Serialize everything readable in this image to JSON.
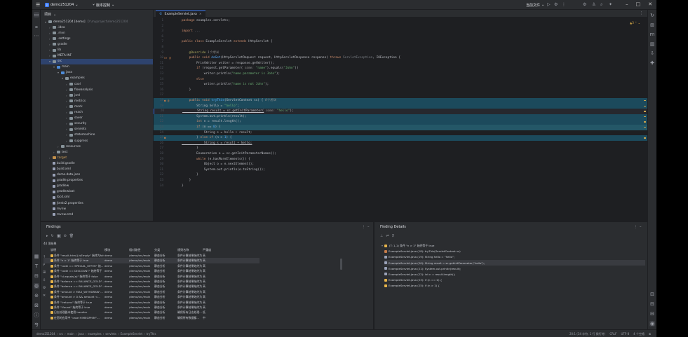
{
  "titlebar": {
    "project_badge": "D",
    "project_name": "demo251204",
    "vcs_branch": "版本控制",
    "run_config": "当前文件",
    "menu_icon": "hamburger-menu-icon"
  },
  "left_strip": [
    "folder-icon",
    "structure-icon",
    "more-icon"
  ],
  "left_strip_bottom": [
    "plugins-icon",
    "terminal-icon",
    "services-icon",
    "problems-icon",
    "debug-icon",
    "git-icon",
    "run-icon",
    "todo-icon"
  ],
  "right_strip": [
    "notifications-icon",
    "database-icon",
    "ai-icon",
    "gradle-icon",
    "chart-icon",
    "copilot-icon"
  ],
  "right_strip_bottom": [
    "bookmarks-icon",
    "structure-icon",
    "outline-icon"
  ],
  "project": {
    "title": "项目",
    "tree": [
      {
        "indent": 1,
        "arrow": "▾",
        "type": "folder",
        "label": "demo251204 [demo]",
        "hint": "D:\\myproject\\demo251204"
      },
      {
        "indent": 2,
        "arrow": "›",
        "type": "folder",
        "label": ".idea"
      },
      {
        "indent": 2,
        "arrow": "›",
        "type": "folder",
        "label": ".mvn"
      },
      {
        "indent": 2,
        "arrow": "›",
        "type": "folder",
        "label": ".settings"
      },
      {
        "indent": 2,
        "arrow": "›",
        "type": "folder",
        "label": "gradle"
      },
      {
        "indent": 2,
        "arrow": "›",
        "type": "folder",
        "label": "lib"
      },
      {
        "indent": 2,
        "arrow": "›",
        "type": "folder",
        "label": "META-INF"
      },
      {
        "indent": 2,
        "arrow": "▾",
        "type": "folder",
        "label": "src",
        "selected": true
      },
      {
        "indent": 3,
        "arrow": "▾",
        "type": "src",
        "label": "main"
      },
      {
        "indent": 4,
        "arrow": "▾",
        "type": "src",
        "label": "java"
      },
      {
        "indent": 5,
        "arrow": "▾",
        "type": "folder",
        "label": "examples"
      },
      {
        "indent": 6,
        "arrow": "›",
        "type": "folder",
        "label": "cool"
      },
      {
        "indent": 6,
        "arrow": "›",
        "type": "folder",
        "label": "flowanalysis"
      },
      {
        "indent": 6,
        "arrow": "›",
        "type": "folder",
        "label": "jsrd"
      },
      {
        "indent": 6,
        "arrow": "›",
        "type": "folder",
        "label": "metrics"
      },
      {
        "indent": 6,
        "arrow": "›",
        "type": "folder",
        "label": "mock"
      },
      {
        "indent": 6,
        "arrow": "›",
        "type": "folder",
        "label": "reach"
      },
      {
        "indent": 6,
        "arrow": "›",
        "type": "folder",
        "label": "saver"
      },
      {
        "indent": 6,
        "arrow": "›",
        "type": "folder",
        "label": "security"
      },
      {
        "indent": 6,
        "arrow": "›",
        "type": "folder",
        "label": "servlets"
      },
      {
        "indent": 6,
        "arrow": "›",
        "type": "folder",
        "label": "statemachine"
      },
      {
        "indent": 6,
        "arrow": "›",
        "type": "folder",
        "label": "suppress"
      },
      {
        "indent": 4,
        "arrow": "›",
        "type": "folder",
        "label": "resources"
      },
      {
        "indent": 3,
        "arrow": "›",
        "type": "folder",
        "label": "test"
      },
      {
        "indent": 2,
        "arrow": "›",
        "type": "target",
        "label": "target",
        "target": true
      },
      {
        "indent": 2,
        "arrow": "",
        "type": "file",
        "label": "build.gradle"
      },
      {
        "indent": 2,
        "arrow": "",
        "type": "file",
        "label": "build.xml"
      },
      {
        "indent": 2,
        "arrow": "",
        "type": "file",
        "label": "demo.data.json"
      },
      {
        "indent": 2,
        "arrow": "",
        "type": "file",
        "label": "gradle.properties"
      },
      {
        "indent": 2,
        "arrow": "",
        "type": "file",
        "label": "gradlew"
      },
      {
        "indent": 2,
        "arrow": "",
        "type": "file",
        "label": "gradlew.bat"
      },
      {
        "indent": 2,
        "arrow": "",
        "type": "file",
        "label": "ibcd.xml"
      },
      {
        "indent": 2,
        "arrow": "",
        "type": "file",
        "label": "jtests2.properties"
      },
      {
        "indent": 2,
        "arrow": "",
        "type": "file",
        "label": "mvnw"
      },
      {
        "indent": 2,
        "arrow": "",
        "type": "file",
        "label": "mvnw.cmd"
      }
    ]
  },
  "editor": {
    "tab": "ExampleServlet.java",
    "inspection_badge": "▲3 ⌃ ⌄",
    "lines": [
      {
        "n": "1",
        "parts": [
          [
            "k",
            "package "
          ],
          [
            "",
            "examples.servlets;"
          ]
        ]
      },
      {
        "n": "2",
        "parts": []
      },
      {
        "n": "3",
        "parts": [
          [
            "k",
            "import "
          ],
          [
            "c",
            "..."
          ]
        ]
      },
      {
        "n": "6",
        "parts": []
      },
      {
        "n": "7",
        "parts": [
          [
            "k",
            "public class "
          ],
          [
            "",
            "ExampleServlet "
          ],
          [
            "k",
            "extends "
          ],
          [
            "",
            "HttpServlet {"
          ]
        ]
      },
      {
        "n": "8",
        "parts": []
      },
      {
        "n": "9",
        "parts": [
          [
            "a",
            "    @Override "
          ],
          [
            "h",
            "1个用法"
          ]
        ]
      },
      {
        "n": "10",
        "gut": "o↑ @",
        "parts": [
          [
            "k",
            "    public void "
          ],
          [
            "f",
            "doGet"
          ],
          [
            "",
            "(HttpServletRequest request, HttpServletResponse response) "
          ],
          [
            "k",
            "throws "
          ],
          [
            "c",
            "ServletException"
          ],
          [
            "",
            ", IOException {"
          ]
        ]
      },
      {
        "n": "11",
        "parts": [
          [
            "",
            "        PrintWriter writer = response.getWriter();"
          ]
        ]
      },
      {
        "n": "12",
        "parts": [
          [
            "k",
            "        if "
          ],
          [
            "",
            "(request.getParameter("
          ],
          [
            "h",
            " name: "
          ],
          [
            "s",
            "\"name\""
          ],
          [
            "",
            ").equals("
          ],
          [
            "s",
            "\"John\""
          ],
          [
            "",
            "))"
          ]
        ]
      },
      {
        "n": "13",
        "parts": [
          [
            "",
            "            writer.println("
          ],
          [
            "s",
            "\"name parameter is John\""
          ],
          [
            "",
            ");"
          ]
        ]
      },
      {
        "n": "14",
        "parts": [
          [
            "k",
            "        else"
          ]
        ]
      },
      {
        "n": "15",
        "parts": [
          [
            "",
            "            writer.println("
          ],
          [
            "s",
            "\"name is not John\""
          ],
          [
            "",
            ");"
          ]
        ]
      },
      {
        "n": "16",
        "parts": [
          [
            "",
            "    }"
          ]
        ]
      },
      {
        "n": "17",
        "parts": []
      },
      {
        "n": "18",
        "gut": "● @",
        "parts": [
          [
            "k",
            "    public void "
          ],
          [
            "f",
            "tryThis"
          ],
          [
            "",
            "(ServletContext sc) { "
          ],
          [
            "h",
            "0个用法"
          ]
        ],
        "hl": "hl"
      },
      {
        "n": "19",
        "parts": [
          [
            "",
            "        String hello = "
          ],
          [
            "s",
            "\"hello\""
          ],
          [
            "",
            ";"
          ]
        ],
        "hl": "hl"
      },
      {
        "n": "20",
        "parts": [
          [
            "u",
            "        String result = sc.getInitParameter("
          ],
          [
            "h",
            " name: "
          ],
          [
            "s",
            "\"hello\""
          ],
          [
            "",
            ");"
          ]
        ],
        "hl": "caret"
      },
      {
        "n": "21",
        "parts": [
          [
            "",
            "        System."
          ],
          [
            "",
            "out"
          ],
          [
            "",
            ".println(result);"
          ]
        ],
        "hl": "hl"
      },
      {
        "n": "22",
        "parts": [
          [
            "k",
            "        int "
          ],
          [
            "",
            "n = result.length();"
          ]
        ],
        "hl": "hl"
      },
      {
        "n": "23",
        "parts": [
          [
            "k",
            "        if "
          ],
          [
            "",
            "(n == "
          ],
          [
            "f",
            "0"
          ],
          [
            "",
            ") {"
          ]
        ],
        "hl": "hlc"
      },
      {
        "n": "24",
        "parts": [
          [
            "",
            "            String s = hello + result;"
          ]
        ]
      },
      {
        "n": "25",
        "gut": "●",
        "parts": [
          [
            "",
            "        } "
          ],
          [
            "k",
            "else if "
          ],
          [
            "",
            "(n > "
          ],
          [
            "f",
            "1"
          ],
          [
            "",
            ") {"
          ]
        ],
        "hl": "hl"
      },
      {
        "n": "26",
        "parts": [
          [
            "u",
            "            String s = result + hello;"
          ]
        ]
      },
      {
        "n": "27",
        "parts": [
          [
            "",
            "        }"
          ]
        ]
      },
      {
        "n": "28",
        "parts": [
          [
            "",
            "        Enumeration e = sc.getInitParameterNames();"
          ]
        ]
      },
      {
        "n": "29",
        "parts": [
          [
            "k",
            "        while "
          ],
          [
            "",
            "(e.hasMoreElements()) {"
          ]
        ]
      },
      {
        "n": "30",
        "parts": [
          [
            "",
            "            Object o = e.nextElement();"
          ]
        ]
      },
      {
        "n": "31",
        "parts": [
          [
            "",
            "            System."
          ],
          [
            "",
            "out"
          ],
          [
            "",
            ".println(o.toString());"
          ]
        ]
      },
      {
        "n": "32",
        "parts": [
          [
            "",
            "        }"
          ]
        ]
      },
      {
        "n": "33",
        "parts": [
          [
            "",
            "    }"
          ]
        ]
      },
      {
        "n": "34",
        "parts": [
          [
            "",
            "}"
          ]
        ]
      }
    ]
  },
  "findings": {
    "title": "Findings",
    "stat": "44 项结果",
    "columns": [
      "说明",
      "模块",
      "相对路径",
      "分类",
      "规则名称",
      "严重度"
    ],
    "rows": [
      [
        "条件 \"result.trim().isEmpty\" 始终为false",
        "demo",
        "/demo/src/main",
        "静态分析",
        "条件计算结果始终为...",
        "高"
      ],
      [
        "条件 \"n > 1\" 始终等于 true",
        "demo",
        "/demo/src/main",
        "静态分析",
        "条件计算结果始终为...",
        "高"
      ],
      [
        "条件 \"code == SPECIAL_OFFER\" 始...",
        "demo",
        "/demo/src/main",
        "静态分析",
        "条件计算结果始终为...",
        "高"
      ],
      [
        "条件 \"code == DISCOUNT\" 始终等于",
        "demo",
        "/demo/src/main",
        "静态分析",
        "条件计算结果始终为...",
        "高"
      ],
      [
        "条件 \"cl.equals(a)\" 始终等于 false",
        "demo",
        "/demo/src/main",
        "静态分析",
        "条件计算结果始终为...",
        "高"
      ],
      [
        "条件 \"balance == BALANCE_GOLD\"...",
        "demo",
        "/demo/src/main",
        "静态分析",
        "条件计算结果始终为...",
        "高"
      ],
      [
        "条件 \"balance == BALANCE_GOLD\"...",
        "demo",
        "/demo/src/main",
        "静态分析",
        "条件计算结果始终为...",
        "高"
      ],
      [
        "条件 \"amount > MAX_WITHDRAW\"...",
        "demo",
        "/demo/src/main",
        "静态分析",
        "条件计算结果始终为...",
        "高"
      ],
      [
        "条件 \"amount > 0 && amount <...",
        "demo",
        "/demo/src/main",
        "静态分析",
        "条件计算结果始终为...",
        "高"
      ],
      [
        "条件 \"!returns\" 始终等于 true",
        "demo",
        "/demo/src/main",
        "静态分析",
        "条件计算结果始终为...",
        "高"
      ],
      [
        "条件 \"!found\" 始终等于 true",
        "demo",
        "/demo/src/main",
        "静态分析",
        "条件计算结果始终为...",
        "高"
      ],
      [
        "日志处理器未使用 handler",
        "demo",
        "/demo/src/main",
        "静态分析",
        "确保所有日志处理...",
        "低"
      ],
      [
        "在您的应用中 \"case HIMEGPHIM\"...",
        "demo",
        "/demo/src/main",
        "静态分析",
        "确保所有数据都...",
        "中"
      ]
    ],
    "side_icons": [
      "up-arrow-icon",
      "filter-icon",
      "group-icon",
      "expand-icon",
      "settings-icon",
      "close-icon"
    ]
  },
  "details": {
    "title": "Finding Details",
    "root": "(T: 1-1) 条件 \"n > 1\" 始终等于 true",
    "items": [
      {
        "icon": "m",
        "text": "ExampleServlet.java (18): tryThis(ServletContext sc)"
      },
      {
        "icon": "f",
        "text": "ExampleServlet.java (19): String hello = \"hello\";"
      },
      {
        "icon": "f",
        "text": "ExampleServlet.java (20): String result = sc.getInitParameter(\"hello\");",
        "sel": true
      },
      {
        "icon": "f",
        "text": "ExampleServlet.java (21): System.out.println(result);"
      },
      {
        "icon": "f",
        "text": "ExampleServlet.java (22): int n = result.length();"
      },
      {
        "icon": "w",
        "text": "ExampleServlet.java (23): if (n == 0) {"
      },
      {
        "icon": "w",
        "text": "ExampleServlet.java (25): if (n > 1) {"
      }
    ]
  },
  "status": {
    "crumbs": [
      "demo251204",
      "src",
      "main",
      "java",
      "examples",
      "servlets",
      "ExampleServlet",
      "tryThis"
    ],
    "right": [
      "20:1 (34 字符, 1 行 换行符)",
      "CRLF",
      "UTF-8",
      "4 个空格"
    ]
  },
  "colors": {
    "accent": "#3574f0",
    "highlight": "#1c4a5c",
    "warning": "#e6b44a"
  }
}
